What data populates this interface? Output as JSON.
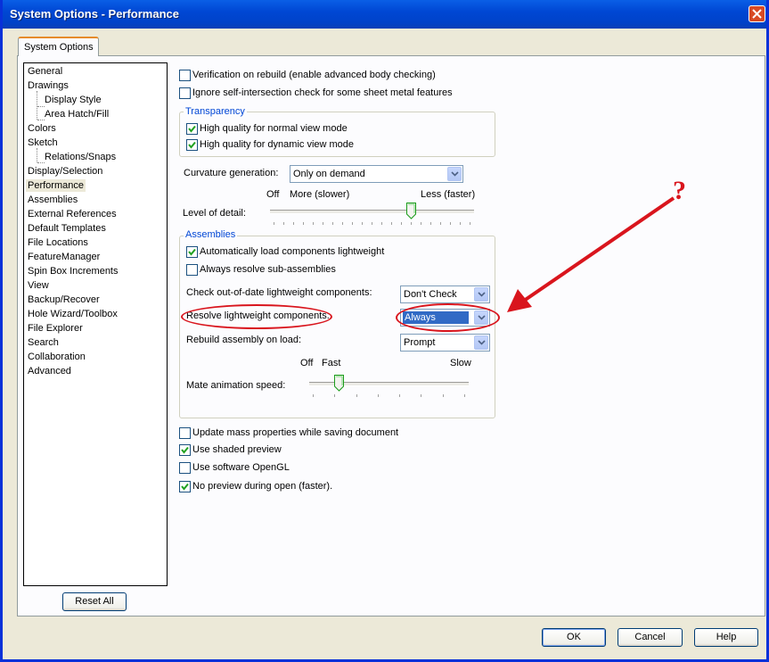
{
  "window": {
    "title": "System Options - Performance"
  },
  "tab": {
    "label": "System Options"
  },
  "tree": {
    "items": [
      {
        "label": "General"
      },
      {
        "label": "Drawings"
      },
      {
        "label": "Display Style"
      },
      {
        "label": "Area Hatch/Fill"
      },
      {
        "label": "Colors"
      },
      {
        "label": "Sketch"
      },
      {
        "label": "Relations/Snaps"
      },
      {
        "label": "Display/Selection"
      },
      {
        "label": "Performance"
      },
      {
        "label": "Assemblies"
      },
      {
        "label": "External References"
      },
      {
        "label": "Default Templates"
      },
      {
        "label": "File Locations"
      },
      {
        "label": "FeatureManager"
      },
      {
        "label": "Spin Box Increments"
      },
      {
        "label": "View"
      },
      {
        "label": "Backup/Recover"
      },
      {
        "label": "Hole Wizard/Toolbox"
      },
      {
        "label": "File Explorer"
      },
      {
        "label": "Search"
      },
      {
        "label": "Collaboration"
      },
      {
        "label": "Advanced"
      }
    ],
    "selected": "Performance"
  },
  "reset_all": "Reset All",
  "options": {
    "verification": {
      "label": "Verification on rebuild (enable advanced body checking)",
      "checked": false
    },
    "ignore_self": {
      "label": "Ignore self-intersection check for some sheet metal features",
      "checked": false
    }
  },
  "transparency": {
    "title": "Transparency",
    "normal": {
      "label": "High quality for normal view mode",
      "checked": true
    },
    "dynamic": {
      "label": "High quality for dynamic view mode",
      "checked": true
    }
  },
  "curvature": {
    "label": "Curvature generation:",
    "value": "Only on demand"
  },
  "level_of_detail": {
    "label": "Level of detail:",
    "off": "Off",
    "more": "More (slower)",
    "less": "Less (faster)",
    "position": 0.7
  },
  "assemblies": {
    "title": "Assemblies",
    "auto_load": {
      "label": "Automatically load components lightweight",
      "checked": true
    },
    "always_resolve": {
      "label": "Always resolve sub-assemblies",
      "checked": false
    },
    "check_out_of_date": {
      "label": "Check out-of-date lightweight components:",
      "value": "Don't Check"
    },
    "resolve_lightweight": {
      "label": "Resolve lightweight components:",
      "value": "Always"
    },
    "rebuild_on_load": {
      "label": "Rebuild assembly on load:",
      "value": "Prompt"
    },
    "mate_speed": {
      "label": "Mate animation speed:",
      "off": "Off",
      "fast": "Fast",
      "slow": "Slow",
      "position": 0.17
    }
  },
  "bottom_options": {
    "update_mass": {
      "label": "Update mass properties while saving document",
      "checked": false
    },
    "shaded_preview": {
      "label": "Use shaded preview",
      "checked": true
    },
    "software_opengl": {
      "label": "Use software OpenGL",
      "checked": false
    },
    "no_preview": {
      "label": "No preview during open (faster).",
      "checked": true
    }
  },
  "annotation": {
    "mark": "?",
    "color": "#d9151d"
  },
  "buttons": {
    "ok": "OK",
    "cancel": "Cancel",
    "help": "Help"
  },
  "colors": {
    "title_bar": "#0047d4",
    "group_title": "#0046d5",
    "accent": "#d9151d"
  }
}
